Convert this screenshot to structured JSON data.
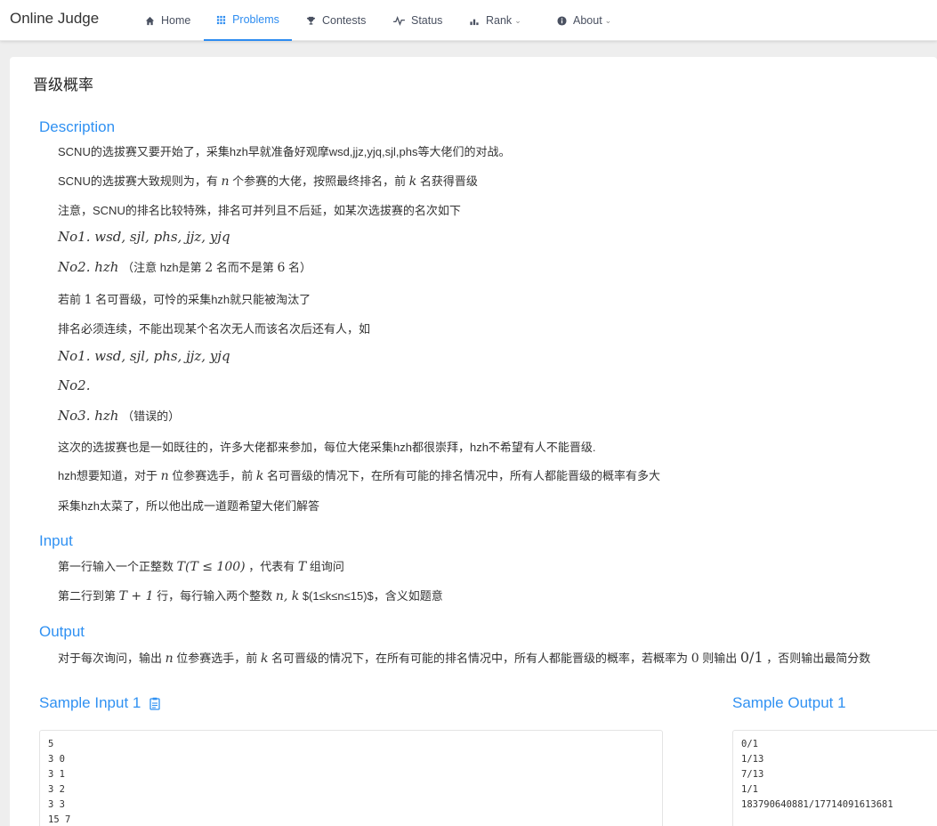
{
  "header": {
    "logo": "Online Judge",
    "nav": [
      {
        "label": "Home",
        "icon": "home-icon"
      },
      {
        "label": "Problems",
        "icon": "grid-icon",
        "active": true
      },
      {
        "label": "Contests",
        "icon": "trophy-icon"
      },
      {
        "label": "Status",
        "icon": "pulse-icon"
      },
      {
        "label": "Rank",
        "icon": "bar-chart-icon",
        "dropdown": true
      },
      {
        "label": "About",
        "icon": "info-icon",
        "dropdown": true
      }
    ]
  },
  "problem": {
    "title": "晋级概率",
    "description_title": "Description",
    "desc": {
      "p1": "SCNU的选拔赛又要开始了，采集hzh早就准备好观摩wsd,jjz,yjq,sjl,phs等大佬们的对战。",
      "p2_a": "SCNU的选拔赛大致规则为，有",
      "p2_n": "n",
      "p2_b": "个参赛的大佬，按照最终排名，前",
      "p2_k": "k",
      "p2_c": "名获得晋级",
      "p3": "注意，SCNU的排名比较特殊，排名可并列且不后延，如某次选拔赛的名次如下",
      "m1": "No1. wsd, sjl, phs, jjz, yjq",
      "m2": "No2. hzh",
      "m2_note_a": "（注意 hzh是第",
      "m2_note_2": "2",
      "m2_note_b": "名而不是第",
      "m2_note_6": "6",
      "m2_note_c": "名）",
      "p4_a": "若前",
      "p4_1": "1",
      "p4_b": "名可晋级，可怜的采集hzh就只能被淘汰了",
      "p5": "排名必须连续，不能出现某个名次无人而该名次后还有人，如",
      "m3": "No1. wsd, sjl, phs, jjz, yjq",
      "m4": "No2.",
      "m5": "No3. hzh",
      "m5_note": "（错误的）",
      "p6": "这次的选拔赛也是一如既往的，许多大佬都来参加，每位大佬采集hzh都很崇拜，hzh不希望有人不能晋级.",
      "p7_a": "hzh想要知道，对于",
      "p7_n": "n",
      "p7_b": "位参赛选手，前",
      "p7_k": "k",
      "p7_c": "名可晋级的情况下，在所有可能的排名情况中，所有人都能晋级的概率有多大",
      "p8": "采集hzh太菜了，所以他出成一道题希望大佬们解答"
    },
    "input_title": "Input",
    "input": {
      "l1_a": "第一行输入一个正整数",
      "l1_m": "T(T ≤ 100)",
      "l1_b": "，代表有",
      "l1_t": "T",
      "l1_c": "组询问",
      "l2_a": "第二行到第",
      "l2_m": "T + 1",
      "l2_b": "行，每行输入两个整数",
      "l2_nk": "n, k",
      "l2_c": "$(1≤k≤n≤15)$，含义如题意"
    },
    "output_title": "Output",
    "output": {
      "a": "对于每次询问，输出",
      "n": "n",
      "b": "位参赛选手，前",
      "k": "k",
      "c": "名可晋级的情况下，在所有可能的排名情况中，所有人都能晋级的概率，若概率为",
      "zero": "0",
      "d": "则输出",
      "frac": "0/1",
      "e": "，否则输出最简分数"
    },
    "sample_input_title": "Sample Input 1",
    "sample_output_title": "Sample Output 1",
    "sample_input": [
      "5",
      "3 0",
      "3 1",
      "3 2",
      "3 3",
      "15 7"
    ],
    "sample_output": [
      "0/1",
      "1/13",
      "7/13",
      "1/1",
      "183790640881/17714091613681"
    ]
  }
}
